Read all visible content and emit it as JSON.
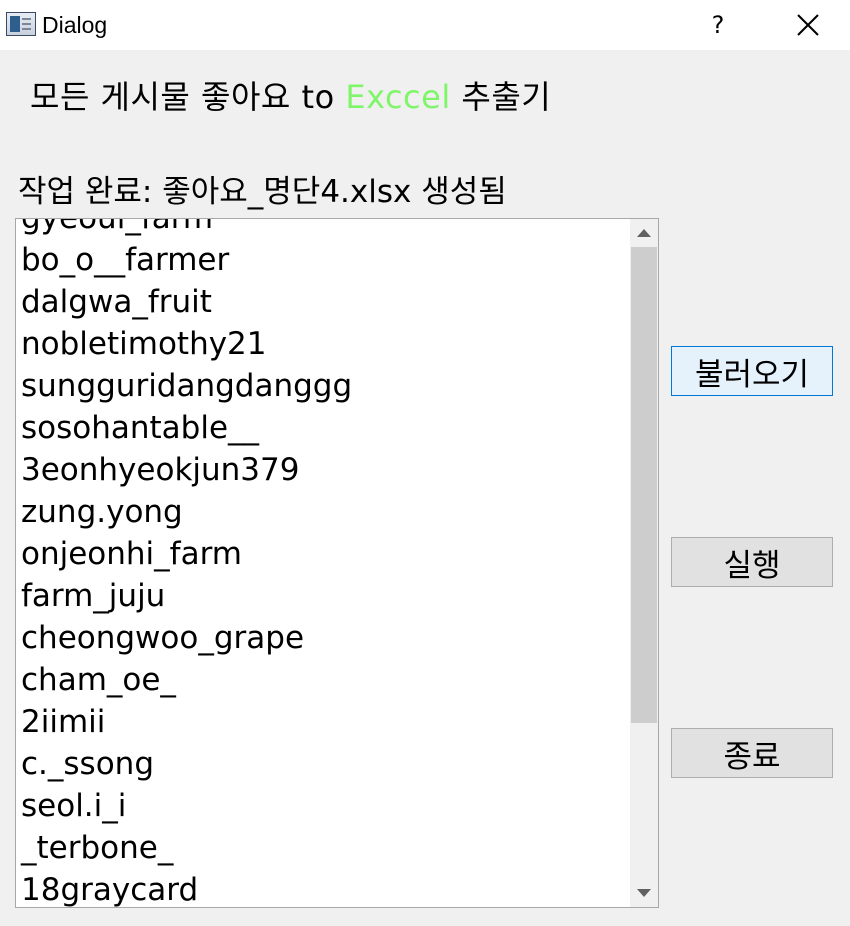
{
  "window": {
    "title": "Dialog",
    "help_label": "?"
  },
  "heading": {
    "prefix": "모든 게시물 좋아요 to ",
    "accent_word": "Exccel",
    "suffix": " 추출기",
    "accent_color": "#7ff56a"
  },
  "status": {
    "text": "작업 완료: 좋아요_명단4.xlsx 생성됨"
  },
  "list": {
    "partial_top_item": "gyeoul_farm",
    "items": [
      "bo_o__farmer",
      "dalgwa_fruit",
      "nobletimothy21",
      "sungguridangdanggg",
      "sosohantable__",
      "3eonhyeokjun379",
      "zung.yong",
      "onjeonhi_farm",
      "farm_juju",
      "cheongwoo_grape",
      "cham_oe_",
      "2iimii",
      "c._ssong",
      "seol.i_i",
      "_terbone_",
      "18graycard"
    ]
  },
  "buttons": {
    "load": "불러오기",
    "run": "실행",
    "exit": "종료"
  },
  "icons": {
    "app": "dialog-app-icon",
    "close": "close-icon",
    "scroll_up": "scroll-up-arrow-icon",
    "scroll_down": "scroll-down-arrow-icon"
  }
}
